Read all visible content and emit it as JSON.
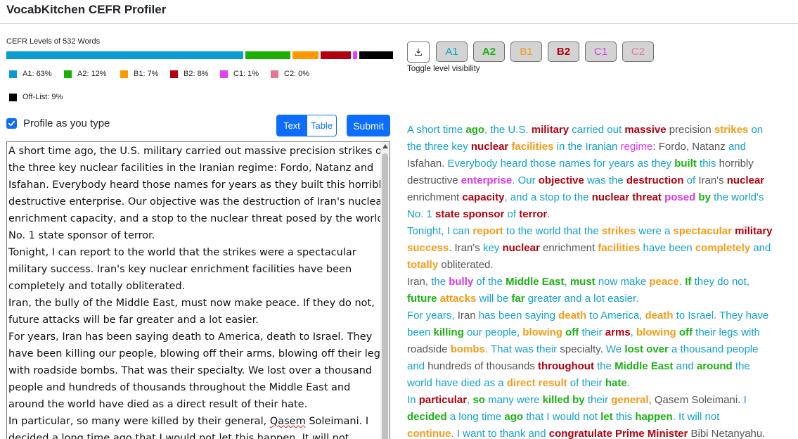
{
  "app": {
    "title": "VocabKitchen CEFR Profiler"
  },
  "levels_bar": {
    "title": "CEFR Levels of 532 Words",
    "segments": [
      {
        "level": "A1",
        "percent": 63,
        "color": "#0a9bd0"
      },
      {
        "level": "A2",
        "percent": 12,
        "color": "#1cb000"
      },
      {
        "level": "B1",
        "percent": 7,
        "color": "#ff9800"
      },
      {
        "level": "B2",
        "percent": 8,
        "color": "#b3000f"
      },
      {
        "level": "C1",
        "percent": 1,
        "color": "#e040fb"
      },
      {
        "level": "C2",
        "percent": 0,
        "color": "#e87590"
      },
      {
        "level": "Off-List",
        "percent": 9,
        "color": "#000000"
      }
    ]
  },
  "legend": {
    "a1": "A1: 63%",
    "a2": "A2: 12%",
    "b1": "B1: 7%",
    "b2": "B2: 8%",
    "c1": "C1: 1%",
    "c2": "C2: 0%",
    "off": "Off-List: 9%"
  },
  "controls": {
    "profile_label": "Profile as you type",
    "profile_checked": true,
    "text_tab": "Text",
    "table_tab": "Table",
    "submit": "Submit",
    "toggle_label": "Toggle level visibility",
    "level_buttons": [
      "A1",
      "A2",
      "B1",
      "B2",
      "C1",
      "C2"
    ]
  },
  "colors": {
    "A1": "#12a1cc",
    "A2": "#1bb214",
    "B1": "#f59c18",
    "B2": "#b3000f",
    "C1": "#db38e8",
    "C2": "#e87c93",
    "OFF": "#555555",
    "accent": "#0d6efd"
  },
  "editor": {
    "lines": [
      "A short time ago, the U.S. military carried out massive precision strikes on",
      "the three key nuclear facilities in the Iranian regime: Fordo, Natanz and",
      "Isfahan. Everybody heard those names for years as they built this horribly",
      "destructive enterprise. Our objective was the destruction of Iran's nuclear",
      "enrichment capacity, and a stop to the nuclear threat posed by the world's",
      "No. 1 state sponsor of terror.",
      "Tonight, I can report to the world that the strikes were a spectacular",
      "military success. Iran's key nuclear enrichment facilities have been",
      "completely and totally obliterated.",
      "Iran, the bully of the Middle East, must now make peace. If they do not,",
      "future attacks will be far greater and a lot easier.",
      "For years, Iran has been saying death to America, death to Israel. They",
      "have been killing our people, blowing off their arms, blowing off their legs",
      "with roadside bombs. That was their specialty. We lost over a thousand",
      "people and hundreds of thousands throughout the Middle East and",
      "around the world have died as a direct result of their hate.",
      "In particular, so many were killed by their general, @@Qasem Soleimani. I",
      "decided a long time ago that I would not let this happen. It will not"
    ]
  },
  "output": {
    "lines": [
      [
        [
          "A1",
          "A short time "
        ],
        [
          "A2b",
          "ago"
        ],
        [
          "A1",
          ", the U.S. "
        ],
        [
          "B2b",
          "military"
        ],
        [
          "A1",
          " carried out "
        ],
        [
          "B2b",
          "massive"
        ],
        [
          "OFF",
          " precision "
        ],
        [
          "B1b",
          "strikes"
        ],
        [
          "A1",
          " on"
        ]
      ],
      [
        [
          "A1",
          "the three key "
        ],
        [
          "B2b",
          "nuclear"
        ],
        [
          "A1",
          " "
        ],
        [
          "B1b",
          "facilities"
        ],
        [
          "A1",
          " in the Iranian "
        ],
        [
          "C1",
          "regime"
        ],
        [
          "OFF",
          ": Fordo, Natanz "
        ],
        [
          "A1",
          "and"
        ]
      ],
      [
        [
          "OFF",
          "Isfahan. "
        ],
        [
          "A1",
          "Everybody heard those names for years as they "
        ],
        [
          "A2b",
          "built"
        ],
        [
          "A1",
          " this "
        ],
        [
          "OFF",
          "horribly"
        ]
      ],
      [
        [
          "OFF",
          "destructive "
        ],
        [
          "C1b",
          "enterprise"
        ],
        [
          "A1",
          ". Our "
        ],
        [
          "B2b",
          "objective"
        ],
        [
          "A1",
          " was the "
        ],
        [
          "B2b",
          "destruction"
        ],
        [
          "A1",
          " of "
        ],
        [
          "OFF",
          "Iran's "
        ],
        [
          "B2b",
          "nuclear"
        ]
      ],
      [
        [
          "OFF",
          "enrichment "
        ],
        [
          "B2b",
          "capacity"
        ],
        [
          "A1",
          ", and a stop to the "
        ],
        [
          "B2b",
          "nuclear threat"
        ],
        [
          "A1",
          " "
        ],
        [
          "C1b",
          "posed"
        ],
        [
          "A1",
          " "
        ],
        [
          "A2b",
          "by"
        ],
        [
          "A1",
          " the world's"
        ]
      ],
      [
        [
          "A1",
          "No. 1 "
        ],
        [
          "B2b",
          "state sponsor"
        ],
        [
          "A1",
          " of "
        ],
        [
          "B2b",
          "terror"
        ],
        [
          "OFF",
          "."
        ]
      ],
      [
        [
          "A1",
          "Tonight, I can "
        ],
        [
          "B1b",
          "report"
        ],
        [
          "A1",
          " to the world that the "
        ],
        [
          "B1b",
          "strikes"
        ],
        [
          "A1",
          " were a "
        ],
        [
          "B1b",
          "spectacular"
        ],
        [
          "A1",
          " "
        ],
        [
          "B2b",
          "military"
        ]
      ],
      [
        [
          "B1b",
          "success"
        ],
        [
          "OFF",
          ". Iran's "
        ],
        [
          "A1",
          "key "
        ],
        [
          "B2b",
          "nuclear"
        ],
        [
          "OFF",
          " enrichment "
        ],
        [
          "B1b",
          "facilities"
        ],
        [
          "A1",
          " have been "
        ],
        [
          "B1b",
          "completely"
        ],
        [
          "A1",
          " and"
        ]
      ],
      [
        [
          "B1b",
          "totally"
        ],
        [
          "OFF",
          " obliterated."
        ]
      ],
      [
        [
          "OFF",
          "Iran, "
        ],
        [
          "A1",
          "the "
        ],
        [
          "C1b",
          "bully"
        ],
        [
          "A1",
          " of the "
        ],
        [
          "A2b",
          "Middle East"
        ],
        [
          "A1",
          ", "
        ],
        [
          "A2b",
          "must"
        ],
        [
          "A1",
          " now make "
        ],
        [
          "B1b",
          "peace"
        ],
        [
          "A1",
          ". "
        ],
        [
          "A2b",
          "If"
        ],
        [
          "A1",
          " they do not,"
        ]
      ],
      [
        [
          "A2b",
          "future"
        ],
        [
          "A1",
          " "
        ],
        [
          "B1b",
          "attacks"
        ],
        [
          "A1",
          " will be "
        ],
        [
          "A2b",
          "far"
        ],
        [
          "A1",
          " greater and a lot easier."
        ]
      ],
      [
        [
          "A1",
          "For years, "
        ],
        [
          "OFF",
          "Iran "
        ],
        [
          "A1",
          "has been saying "
        ],
        [
          "B1b",
          "death"
        ],
        [
          "A1",
          " to America, "
        ],
        [
          "B1b",
          "death"
        ],
        [
          "A1",
          " to Israel. They have"
        ]
      ],
      [
        [
          "A1",
          "been "
        ],
        [
          "A2b",
          "killing"
        ],
        [
          "A1",
          " our people, "
        ],
        [
          "B1b",
          "blowing"
        ],
        [
          "A1",
          " "
        ],
        [
          "A2b",
          "off"
        ],
        [
          "A1",
          " their "
        ],
        [
          "B2b",
          "arms"
        ],
        [
          "A1",
          ", "
        ],
        [
          "B1b",
          "blowing"
        ],
        [
          "A1",
          " "
        ],
        [
          "A2b",
          "off"
        ],
        [
          "A1",
          " their legs with"
        ]
      ],
      [
        [
          "OFF",
          "roadside "
        ],
        [
          "B1b",
          "bombs"
        ],
        [
          "A1",
          ". That was their "
        ],
        [
          "OFF",
          "specialty. "
        ],
        [
          "A1",
          "We "
        ],
        [
          "A2b",
          "lost over"
        ],
        [
          "A1",
          " a thousand people"
        ]
      ],
      [
        [
          "A1",
          "and "
        ],
        [
          "OFF",
          "hundreds of thousands "
        ],
        [
          "B2b",
          "throughout"
        ],
        [
          "A1",
          " the "
        ],
        [
          "A2b",
          "Middle East"
        ],
        [
          "A1",
          " and "
        ],
        [
          "A2b",
          "around"
        ],
        [
          "A1",
          " the"
        ]
      ],
      [
        [
          "A1",
          "world have died as a "
        ],
        [
          "B1b",
          "direct result"
        ],
        [
          "A1",
          " of their "
        ],
        [
          "A2b",
          "hate"
        ],
        [
          "OFF",
          "."
        ]
      ],
      [
        [
          "A1",
          "In "
        ],
        [
          "B2b",
          "particular"
        ],
        [
          "A1",
          ", "
        ],
        [
          "A2b",
          "so"
        ],
        [
          "A1",
          " many were "
        ],
        [
          "A2b",
          "killed by"
        ],
        [
          "A1",
          " their "
        ],
        [
          "B1b",
          "general"
        ],
        [
          "OFF",
          ", Qasem Soleimani. "
        ],
        [
          "A1",
          "I"
        ]
      ],
      [
        [
          "A2b",
          "decided"
        ],
        [
          "A1",
          " a long time "
        ],
        [
          "A2b",
          "ago"
        ],
        [
          "A1",
          " that I would not "
        ],
        [
          "A2b",
          "let"
        ],
        [
          "A1",
          " this "
        ],
        [
          "A2b",
          "happen"
        ],
        [
          "A1",
          ". It will not"
        ]
      ],
      [
        [
          "B1b",
          "continue"
        ],
        [
          "A1",
          ". I want to thank and "
        ],
        [
          "B2b",
          "congratulate Prime Minister"
        ],
        [
          "OFF",
          " Bibi Netanyahu."
        ]
      ]
    ]
  }
}
